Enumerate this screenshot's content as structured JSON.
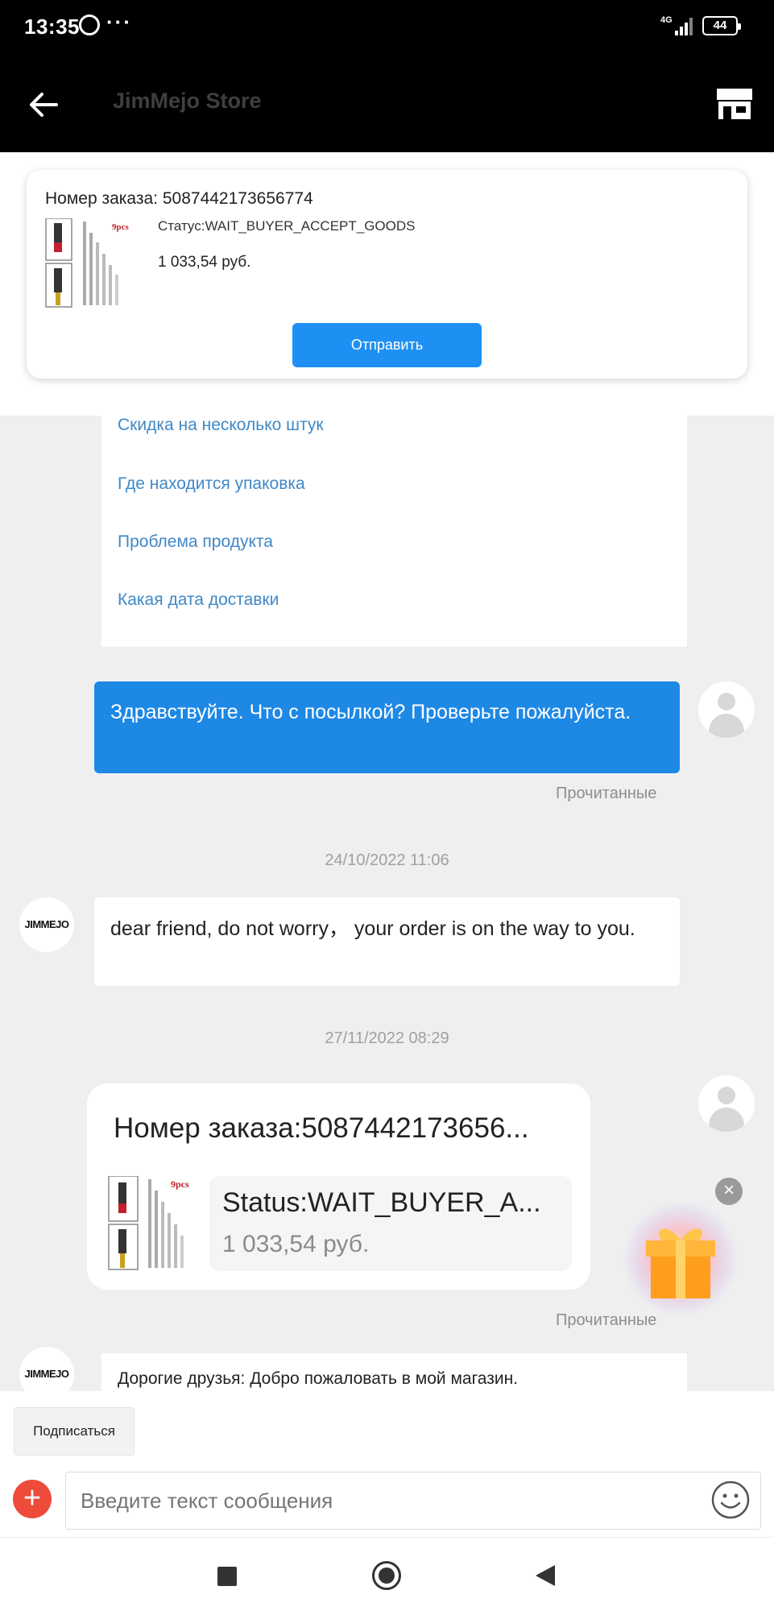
{
  "status_bar": {
    "time": "13:35",
    "network": "4G",
    "battery": "44"
  },
  "header": {
    "title": "JimMejo Store",
    "back_icon": "arrow-left-icon",
    "store_icon": "storefront-icon"
  },
  "order_card": {
    "order_number": "Номер заказа: 5087442173656774",
    "thumbnail_text": "9pcs",
    "status": "Статус:WAIT_BUYER_ACCEPT_GOODS",
    "price": "1 033,54 руб.",
    "send_label": "Отправить"
  },
  "quick_replies": [
    "Скидка на несколько штук",
    "Где находится упаковка",
    "Проблема продукта",
    "Какая дата доставки"
  ],
  "chat": {
    "user_message": "Здравствуйте. Что с посылкой? Проверьте пожалуйста.",
    "read_label": "Прочитанные",
    "timestamp_1": "24/10/2022 11:06",
    "store_avatar_text": "JIMMEJO",
    "store_message": "dear friend, do not worry， your order is on the way to you.",
    "timestamp_2": "27/11/2022 08:29",
    "order_bubble": {
      "order_number": "Номер заказа:5087442173656...",
      "status": "Status:WAIT_BUYER_A...",
      "price": "1 033,54 руб.",
      "thumbnail_text": "9pcs"
    },
    "read_label_2": "Прочитанные",
    "store_message_2": "Дорогие друзья: Добро пожаловать в мой магазин."
  },
  "gift": {
    "icon": "gift-icon",
    "close_icon": "close-icon"
  },
  "bottom": {
    "subscribe_label": "Подписаться",
    "input_placeholder": "Введите текст сообщения",
    "plus_icon": "plus-icon",
    "emoji_icon": "smiley-icon"
  },
  "colors": {
    "accent": "#1e88e5",
    "send_button": "#1e90f4",
    "quick_reply_text": "#3f88c7",
    "plus_button": "#ee4b3a"
  }
}
